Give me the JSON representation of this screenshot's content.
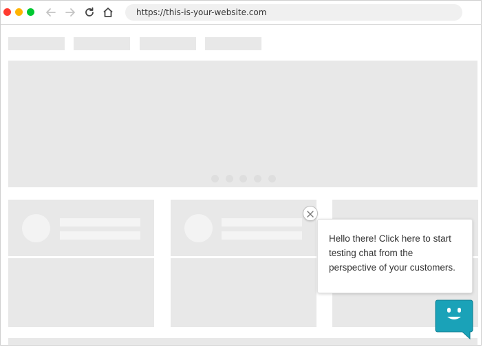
{
  "browser": {
    "url": "https://this-is-your-website.com"
  },
  "icons": {
    "back": "back-arrow-icon",
    "forward": "forward-arrow-icon",
    "reload": "reload-icon",
    "home": "home-icon",
    "close": "close-icon",
    "chat": "chat-bot-icon"
  },
  "chat_popup": {
    "message": "Hello there! Click here to start testing chat from the perspective of your customers."
  },
  "colors": {
    "traffic_red": "#ff3b30",
    "traffic_yellow": "#ffb400",
    "traffic_green": "#00c832",
    "placeholder": "#e8e8e8",
    "chat_accent": "#1aa2b8"
  },
  "carousel": {
    "dot_count": 5
  }
}
